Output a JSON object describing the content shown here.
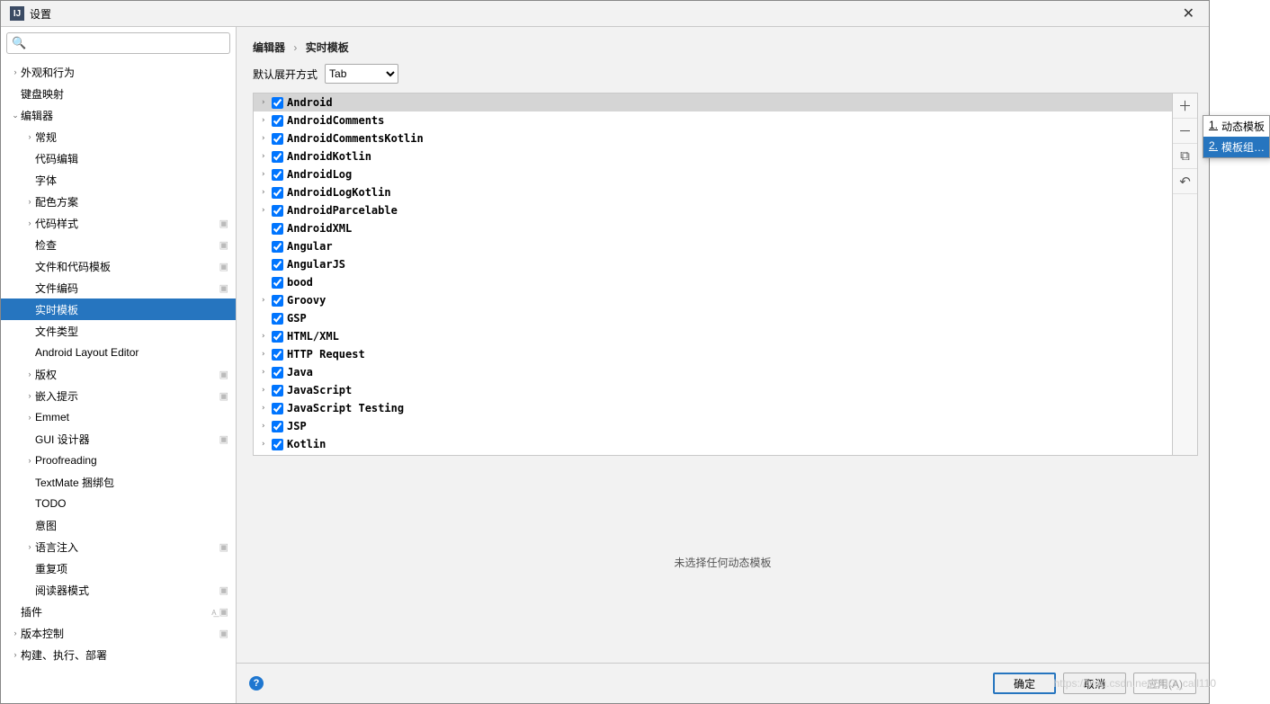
{
  "window": {
    "title": "设置"
  },
  "search": {
    "placeholder": ""
  },
  "sidebar": {
    "items": [
      {
        "label": "外观和行为",
        "indent": 0,
        "exp": "›",
        "badge": ""
      },
      {
        "label": "键盘映射",
        "indent": 0,
        "exp": "",
        "badge": ""
      },
      {
        "label": "编辑器",
        "indent": 0,
        "exp": "⌄",
        "badge": ""
      },
      {
        "label": "常规",
        "indent": 1,
        "exp": "›",
        "badge": ""
      },
      {
        "label": "代码编辑",
        "indent": 1,
        "exp": "",
        "badge": ""
      },
      {
        "label": "字体",
        "indent": 1,
        "exp": "",
        "badge": ""
      },
      {
        "label": "配色方案",
        "indent": 1,
        "exp": "›",
        "badge": ""
      },
      {
        "label": "代码样式",
        "indent": 1,
        "exp": "›",
        "badge": "▣"
      },
      {
        "label": "检查",
        "indent": 1,
        "exp": "",
        "badge": "▣"
      },
      {
        "label": "文件和代码模板",
        "indent": 1,
        "exp": "",
        "badge": "▣"
      },
      {
        "label": "文件编码",
        "indent": 1,
        "exp": "",
        "badge": "▣"
      },
      {
        "label": "实时模板",
        "indent": 1,
        "exp": "",
        "badge": "",
        "selected": true
      },
      {
        "label": "文件类型",
        "indent": 1,
        "exp": "",
        "badge": ""
      },
      {
        "label": "Android Layout Editor",
        "indent": 1,
        "exp": "",
        "badge": ""
      },
      {
        "label": "版权",
        "indent": 1,
        "exp": "›",
        "badge": "▣"
      },
      {
        "label": "嵌入提示",
        "indent": 1,
        "exp": "›",
        "badge": "▣"
      },
      {
        "label": "Emmet",
        "indent": 1,
        "exp": "›",
        "badge": ""
      },
      {
        "label": "GUI 设计器",
        "indent": 1,
        "exp": "",
        "badge": "▣"
      },
      {
        "label": "Proofreading",
        "indent": 1,
        "exp": "›",
        "badge": ""
      },
      {
        "label": "TextMate 捆绑包",
        "indent": 1,
        "exp": "",
        "badge": ""
      },
      {
        "label": "TODO",
        "indent": 1,
        "exp": "",
        "badge": ""
      },
      {
        "label": "意图",
        "indent": 1,
        "exp": "",
        "badge": ""
      },
      {
        "label": "语言注入",
        "indent": 1,
        "exp": "›",
        "badge": "▣"
      },
      {
        "label": "重复项",
        "indent": 1,
        "exp": "",
        "badge": ""
      },
      {
        "label": "阅读器模式",
        "indent": 1,
        "exp": "",
        "badge": "▣"
      },
      {
        "label": "插件",
        "indent": 0,
        "exp": "",
        "badge": "ᴀ̲ ▣"
      },
      {
        "label": "版本控制",
        "indent": 0,
        "exp": "›",
        "badge": "▣"
      },
      {
        "label": "构建、执行、部署",
        "indent": 0,
        "exp": "›",
        "badge": ""
      }
    ]
  },
  "breadcrumb": {
    "part1": "编辑器",
    "part2": "实时模板"
  },
  "expand": {
    "label": "默认展开方式",
    "value": "Tab"
  },
  "templates": [
    {
      "name": "Android",
      "chev": "›",
      "sel": true
    },
    {
      "name": "AndroidComments",
      "chev": "›"
    },
    {
      "name": "AndroidCommentsKotlin",
      "chev": "›"
    },
    {
      "name": "AndroidKotlin",
      "chev": "›"
    },
    {
      "name": "AndroidLog",
      "chev": "›"
    },
    {
      "name": "AndroidLogKotlin",
      "chev": "›"
    },
    {
      "name": "AndroidParcelable",
      "chev": "›"
    },
    {
      "name": "AndroidXML",
      "chev": ""
    },
    {
      "name": "Angular",
      "chev": ""
    },
    {
      "name": "AngularJS",
      "chev": ""
    },
    {
      "name": "bood",
      "chev": ""
    },
    {
      "name": "Groovy",
      "chev": "›"
    },
    {
      "name": "GSP",
      "chev": ""
    },
    {
      "name": "HTML/XML",
      "chev": "›"
    },
    {
      "name": "HTTP Request",
      "chev": "›"
    },
    {
      "name": "Java",
      "chev": "›"
    },
    {
      "name": "JavaScript",
      "chev": "›"
    },
    {
      "name": "JavaScript Testing",
      "chev": "›"
    },
    {
      "name": "JSP",
      "chev": "›"
    },
    {
      "name": "Kotlin",
      "chev": "›"
    }
  ],
  "no_selection_text": "未选择任何动态模板",
  "context_menu": {
    "items": [
      {
        "num": "1",
        "text": "动态模板"
      },
      {
        "num": "2",
        "text": "模板组…",
        "hover": true
      }
    ]
  },
  "footer": {
    "ok": "确定",
    "cancel": "取消",
    "apply": "应用(A)"
  },
  "watermark": "https://blog.csdn.net/BUG_call110"
}
